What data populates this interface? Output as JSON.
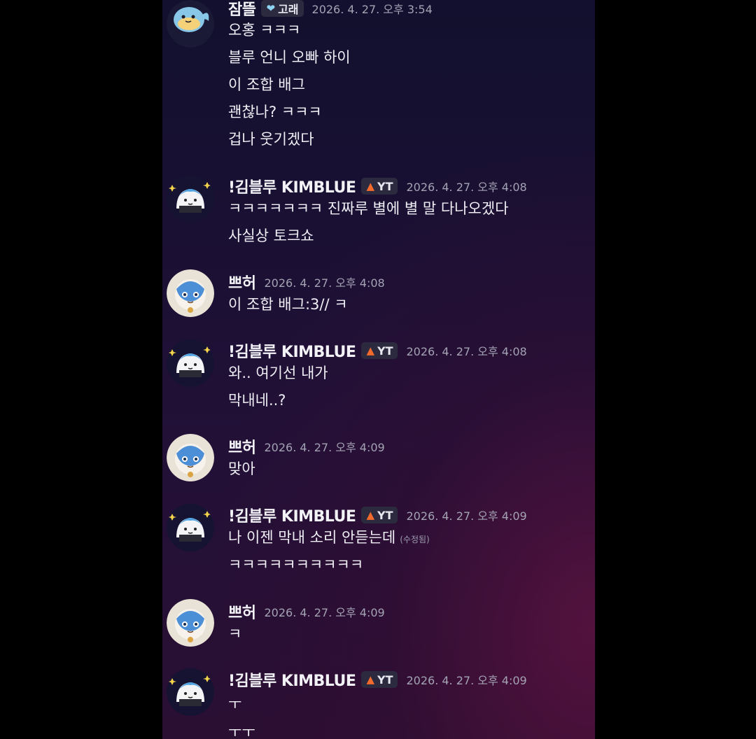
{
  "messages": [
    {
      "author": "잠뜰",
      "badge": "고래",
      "badge_icon": "heart-icon",
      "time": "2026. 4. 27. 오후 3:54",
      "lines": [
        "오홍 ㅋㅋㅋ",
        "블루 언니 오빠 하이",
        "이 조합 배그",
        "괜찮나? ㅋㅋㅋ",
        "겁나 웃기겠다"
      ]
    },
    {
      "author": "!김블루 KIMBLUE",
      "badge": "YT",
      "badge_icon": "fire-icon",
      "time": "2026. 4. 27. 오후 4:08",
      "lines": [
        "ㅋㅋㅋㅋㅋㅋㅋ 진짜루 별에 별 말 다나오겠다",
        "사실상 토크쇼"
      ]
    },
    {
      "author": "쁘허",
      "time": "2026. 4. 27. 오후 4:08",
      "lines": [
        "이 조합 배그:3// ㅋ"
      ]
    },
    {
      "author": "!김블루 KIMBLUE",
      "badge": "YT",
      "badge_icon": "fire-icon",
      "time": "2026. 4. 27. 오후 4:08",
      "lines": [
        "와.. 여기선 내가",
        "막내네..?"
      ]
    },
    {
      "author": "쁘허",
      "time": "2026. 4. 27. 오후 4:09",
      "lines": [
        "맞아"
      ]
    },
    {
      "author": "!김블루 KIMBLUE",
      "badge": "YT",
      "badge_icon": "fire-icon",
      "time": "2026. 4. 27. 오후 4:09",
      "lines": [
        "나 이젠 막내 소리 안듣는데",
        "ㅋㅋㅋㅋㅋㅋㅋㅋㅋㅋ"
      ],
      "edited_label": "(수정됨)"
    },
    {
      "author": "쁘허",
      "time": "2026. 4. 27. 오후 4:09",
      "lines": [
        "ㅋ"
      ]
    },
    {
      "author": "!김블루 KIMBLUE",
      "badge": "YT",
      "badge_icon": "fire-icon",
      "time": "2026. 4. 27. 오후 4:09",
      "lines": [
        "ㅜ",
        "ㅜㅜ"
      ]
    }
  ],
  "colors": {
    "page_background": "#000000",
    "chat_background_top": "#12102e",
    "chat_background_bottom": "#2a0f33",
    "name_text": "#f2f2f6",
    "timestamp_text": "#a3a3b4",
    "badge_background": "#2b2a3e",
    "heart_badge": "#8fd3f5",
    "fire_badge": "#f36a2d"
  }
}
